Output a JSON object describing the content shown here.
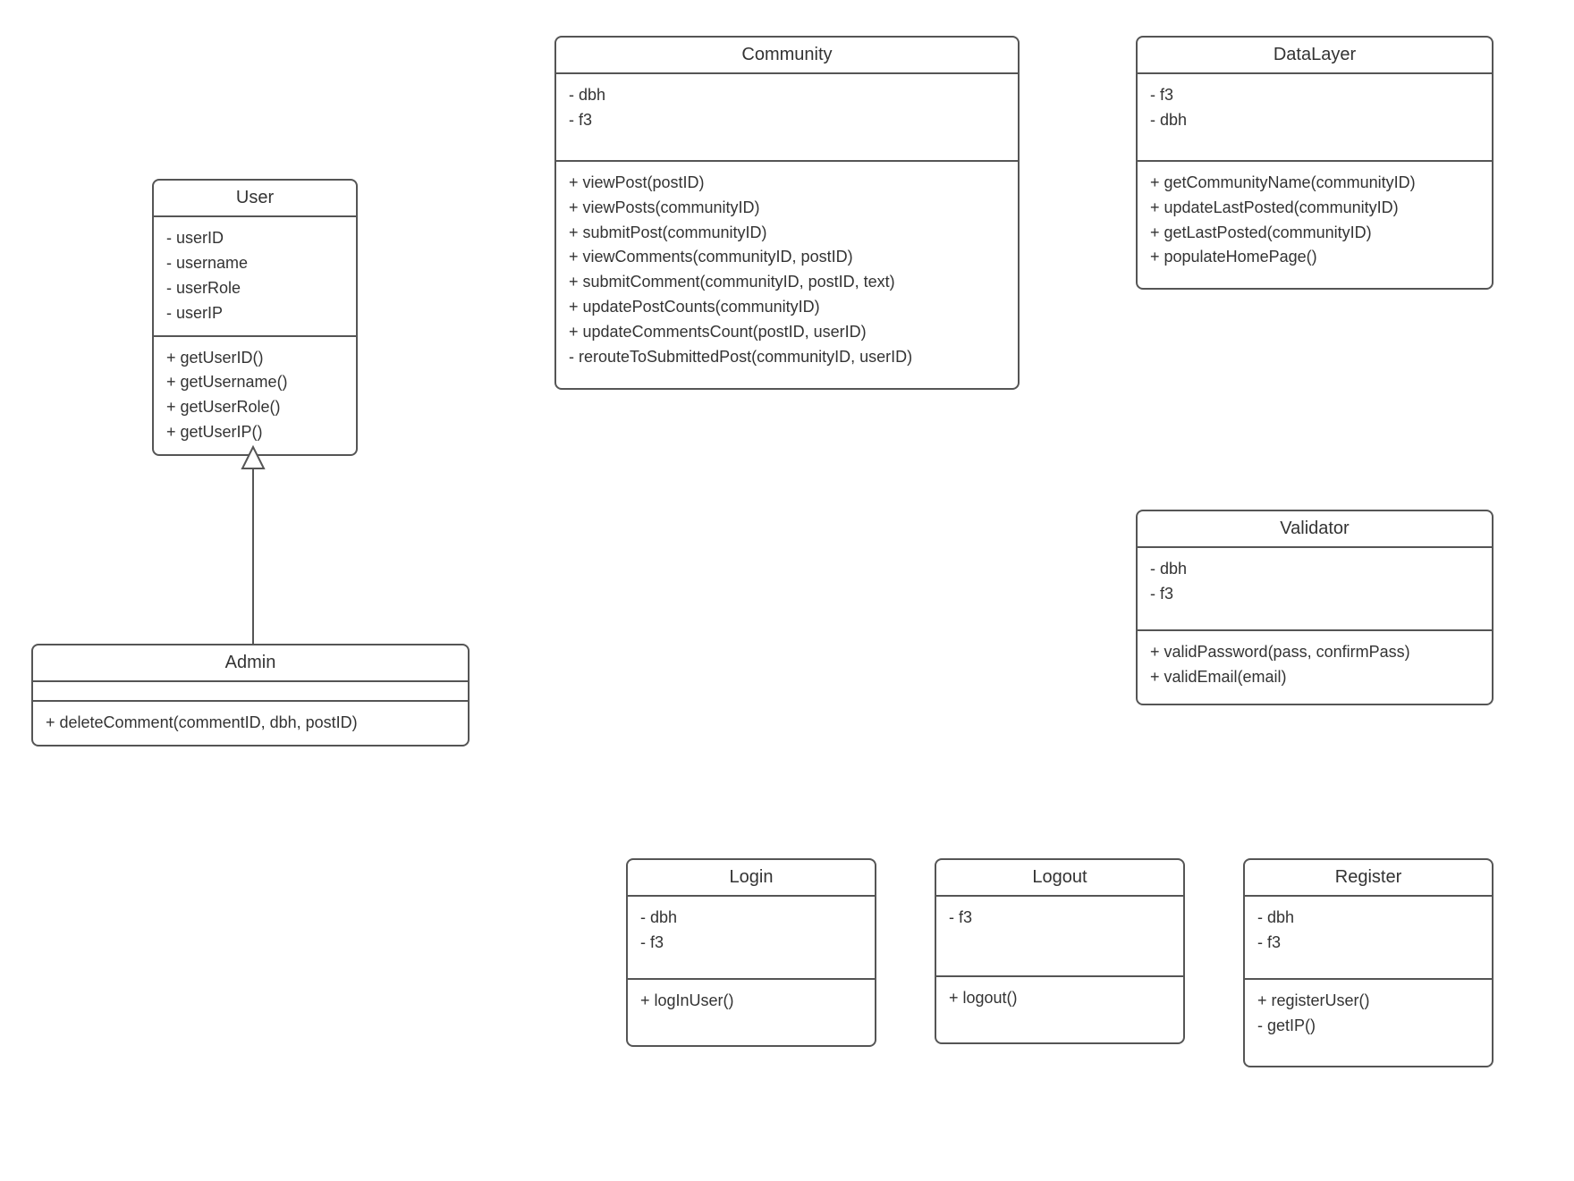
{
  "diagram_type": "UML Class Diagram",
  "classes": {
    "user": {
      "name": "User",
      "attributes": [
        "- userID",
        "- username",
        "- userRole",
        "- userIP"
      ],
      "methods": [
        "+ getUserID()",
        "+ getUsername()",
        "+ getUserRole()",
        "+ getUserIP()"
      ]
    },
    "admin": {
      "name": "Admin",
      "attributes": [],
      "methods": [
        "+ deleteComment(commentID, dbh, postID)"
      ]
    },
    "community": {
      "name": "Community",
      "attributes": [
        "- dbh",
        "- f3"
      ],
      "methods": [
        "+ viewPost(postID)",
        "+ viewPosts(communityID)",
        "+ submitPost(communityID)",
        "+ viewComments(communityID, postID)",
        "+ submitComment(communityID, postID, text)",
        "+ updatePostCounts(communityID)",
        "+ updateCommentsCount(postID, userID)",
        "- rerouteToSubmittedPost(communityID, userID)"
      ]
    },
    "datalayer": {
      "name": "DataLayer",
      "attributes": [
        "- f3",
        "- dbh"
      ],
      "methods": [
        "+ getCommunityName(communityID)",
        "+ updateLastPosted(communityID)",
        "+ getLastPosted(communityID)",
        "+ populateHomePage()"
      ]
    },
    "validator": {
      "name": "Validator",
      "attributes": [
        "- dbh",
        "- f3"
      ],
      "methods": [
        "+ validPassword(pass, confirmPass)",
        "+ validEmail(email)"
      ]
    },
    "login": {
      "name": "Login",
      "attributes": [
        "- dbh",
        "- f3"
      ],
      "methods": [
        "+ logInUser()"
      ]
    },
    "logout": {
      "name": "Logout",
      "attributes": [
        "- f3"
      ],
      "methods": [
        "+ logout()"
      ]
    },
    "register": {
      "name": "Register",
      "attributes": [
        "- dbh",
        "- f3"
      ],
      "methods": [
        "+ registerUser()",
        "- getIP()"
      ]
    }
  },
  "relationships": [
    {
      "from": "Admin",
      "to": "User",
      "type": "generalization"
    }
  ]
}
